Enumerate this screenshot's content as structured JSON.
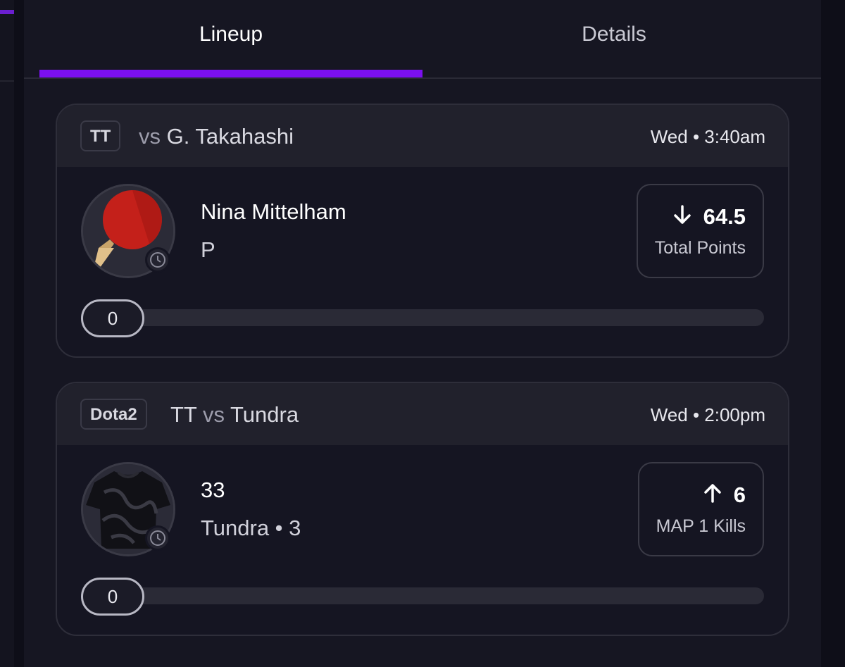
{
  "tabs": [
    {
      "label": "Lineup",
      "active": true
    },
    {
      "label": "Details",
      "active": false
    }
  ],
  "colors": {
    "accent": "#7b10f0",
    "background": "#0e0e18",
    "panel": "#161622",
    "card_header": "#21212c"
  },
  "cards": [
    {
      "tag": "TT",
      "matchup": {
        "team": "",
        "vs": "vs",
        "opponent": "G. Takahashi"
      },
      "time": "Wed • 3:40am",
      "avatar_icon": "ping-pong-paddle-icon",
      "player_name": "Nina Mittelham",
      "player_sub": "P",
      "stat": {
        "direction": "down",
        "arrow_icon": "arrow-down-icon",
        "value": "64.5",
        "label": "Total Points"
      },
      "progress": {
        "current": "0",
        "fraction": 0
      }
    },
    {
      "tag": "Dota2",
      "matchup": {
        "team": "TT",
        "vs": "vs",
        "opponent": "Tundra"
      },
      "time": "Wed • 2:00pm",
      "avatar_icon": "jersey-icon",
      "player_name": "33",
      "player_sub": "Tundra • 3",
      "stat": {
        "direction": "up",
        "arrow_icon": "arrow-up-icon",
        "value": "6",
        "label": "MAP 1 Kills"
      },
      "progress": {
        "current": "0",
        "fraction": 0
      }
    }
  ]
}
